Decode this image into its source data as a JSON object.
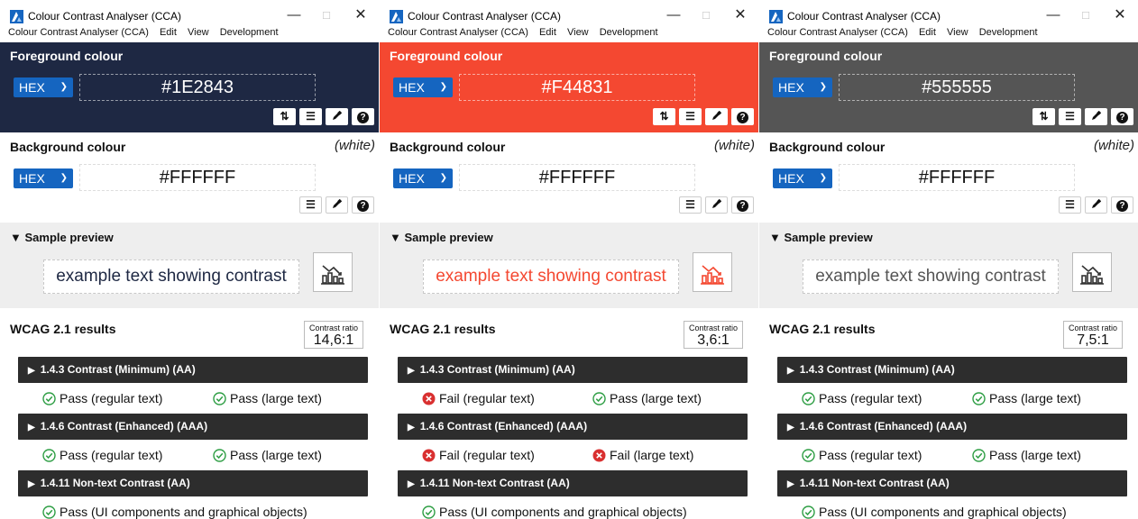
{
  "windows": [
    {
      "title": "Colour Contrast Analyser (CCA)",
      "menu": [
        "Colour Contrast Analyser (CCA)",
        "Edit",
        "View",
        "Development"
      ],
      "foreground": {
        "label": "Foreground colour",
        "format": "HEX",
        "hex": "#1E2843",
        "color": "#1e2843",
        "text_color": "#ffffff"
      },
      "background": {
        "label": "Background colour",
        "name": "(white)",
        "format": "HEX",
        "hex": "#FFFFFF"
      },
      "preview": {
        "label": "Sample preview",
        "text": "example text showing contrast",
        "text_color": "#1e2843"
      },
      "results": {
        "label": "WCAG 2.1 results",
        "ratio_label": "Contrast ratio",
        "ratio": "14,6:1",
        "criteria": [
          {
            "title": "1.4.3 Contrast (Minimum) (AA)",
            "items": [
              {
                "text": "Pass (regular text)",
                "status": "pass"
              },
              {
                "text": "Pass (large text)",
                "status": "pass"
              }
            ]
          },
          {
            "title": "1.4.6 Contrast (Enhanced) (AAA)",
            "items": [
              {
                "text": "Pass (regular text)",
                "status": "pass"
              },
              {
                "text": "Pass (large text)",
                "status": "pass"
              }
            ]
          },
          {
            "title": "1.4.11 Non-text Contrast (AA)",
            "items": [
              {
                "text": "Pass (UI components and graphical objects)",
                "status": "pass"
              }
            ]
          }
        ]
      }
    },
    {
      "title": "Colour Contrast Analyser (CCA)",
      "menu": [
        "Colour Contrast Analyser (CCA)",
        "Edit",
        "View",
        "Development"
      ],
      "foreground": {
        "label": "Foreground colour",
        "format": "HEX",
        "hex": "#F44831",
        "color": "#f44831",
        "text_color": "#ffffff"
      },
      "background": {
        "label": "Background colour",
        "name": "(white)",
        "format": "HEX",
        "hex": "#FFFFFF"
      },
      "preview": {
        "label": "Sample preview",
        "text": "example text showing contrast",
        "text_color": "#f44831"
      },
      "results": {
        "label": "WCAG 2.1 results",
        "ratio_label": "Contrast ratio",
        "ratio": "3,6:1",
        "criteria": [
          {
            "title": "1.4.3 Contrast (Minimum) (AA)",
            "items": [
              {
                "text": "Fail (regular text)",
                "status": "fail"
              },
              {
                "text": "Pass (large text)",
                "status": "pass"
              }
            ]
          },
          {
            "title": "1.4.6 Contrast (Enhanced) (AAA)",
            "items": [
              {
                "text": "Fail (regular text)",
                "status": "fail"
              },
              {
                "text": "Fail (large text)",
                "status": "fail"
              }
            ]
          },
          {
            "title": "1.4.11 Non-text Contrast (AA)",
            "items": [
              {
                "text": "Pass (UI components and graphical objects)",
                "status": "pass"
              }
            ]
          }
        ]
      }
    },
    {
      "title": "Colour Contrast Analyser (CCA)",
      "menu": [
        "Colour Contrast Analyser (CCA)",
        "Edit",
        "View",
        "Development"
      ],
      "foreground": {
        "label": "Foreground colour",
        "format": "HEX",
        "hex": "#555555",
        "color": "#555555",
        "text_color": "#ffffff"
      },
      "background": {
        "label": "Background colour",
        "name": "(white)",
        "format": "HEX",
        "hex": "#FFFFFF"
      },
      "preview": {
        "label": "Sample preview",
        "text": "example text showing contrast",
        "text_color": "#555555"
      },
      "results": {
        "label": "WCAG 2.1 results",
        "ratio_label": "Contrast ratio",
        "ratio": "7,5:1",
        "criteria": [
          {
            "title": "1.4.3 Contrast (Minimum) (AA)",
            "items": [
              {
                "text": "Pass (regular text)",
                "status": "pass"
              },
              {
                "text": "Pass (large text)",
                "status": "pass"
              }
            ]
          },
          {
            "title": "1.4.6 Contrast (Enhanced) (AAA)",
            "items": [
              {
                "text": "Pass (regular text)",
                "status": "pass"
              },
              {
                "text": "Pass (large text)",
                "status": "pass"
              }
            ]
          },
          {
            "title": "1.4.11 Non-text Contrast (AA)",
            "items": [
              {
                "text": "Pass (UI components and graphical objects)",
                "status": "pass"
              }
            ]
          }
        ]
      }
    }
  ],
  "colors": {
    "accent": "#1565c0",
    "pass": "#2e9e44",
    "fail": "#d93030",
    "criterion_bar": "#2d2d2d",
    "preview_bg": "#eeeeee"
  },
  "icons": [
    "app-icon",
    "minimize-icon",
    "maximize-icon",
    "close-icon",
    "chevron-down-icon",
    "swap-icon",
    "sliders-icon",
    "eyedropper-icon",
    "help-icon",
    "triangle-down-icon",
    "triangle-right-icon",
    "chart-icon",
    "pass-icon",
    "fail-icon"
  ]
}
